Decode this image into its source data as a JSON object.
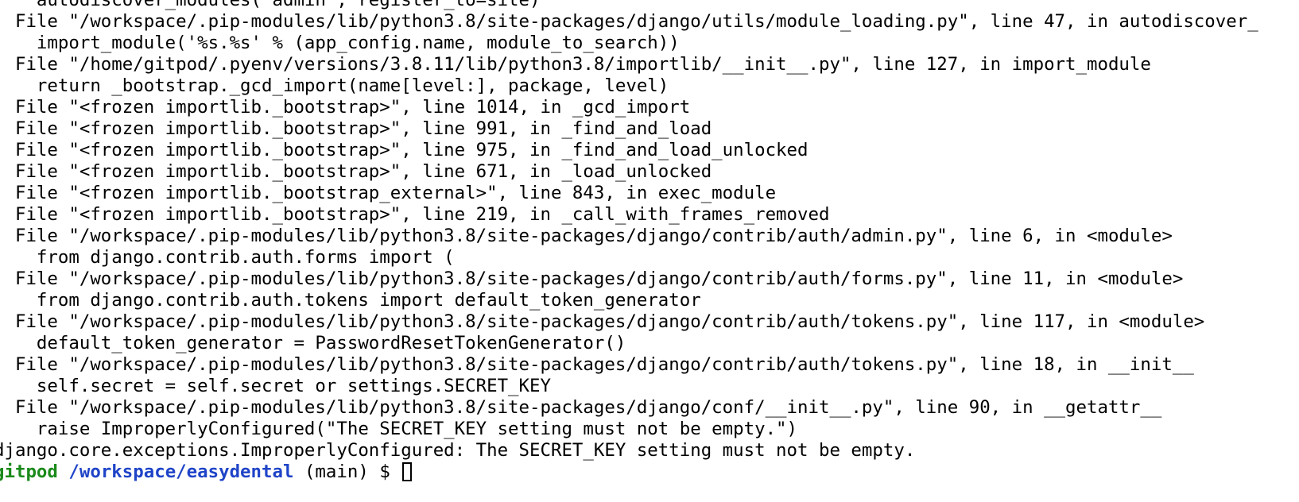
{
  "terminal": {
    "output_lines": [
      "    autodiscover_modules('admin', register_to=site)",
      "  File \"/workspace/.pip-modules/lib/python3.8/site-packages/django/utils/module_loading.py\", line 47, in autodiscover_",
      "    import_module('%s.%s' % (app_config.name, module_to_search))",
      "  File \"/home/gitpod/.pyenv/versions/3.8.11/lib/python3.8/importlib/__init__.py\", line 127, in import_module",
      "    return _bootstrap._gcd_import(name[level:], package, level)",
      "  File \"<frozen importlib._bootstrap>\", line 1014, in _gcd_import",
      "  File \"<frozen importlib._bootstrap>\", line 991, in _find_and_load",
      "  File \"<frozen importlib._bootstrap>\", line 975, in _find_and_load_unlocked",
      "  File \"<frozen importlib._bootstrap>\", line 671, in _load_unlocked",
      "  File \"<frozen importlib._bootstrap_external>\", line 843, in exec_module",
      "  File \"<frozen importlib._bootstrap>\", line 219, in _call_with_frames_removed",
      "  File \"/workspace/.pip-modules/lib/python3.8/site-packages/django/contrib/auth/admin.py\", line 6, in <module>",
      "    from django.contrib.auth.forms import (",
      "  File \"/workspace/.pip-modules/lib/python3.8/site-packages/django/contrib/auth/forms.py\", line 11, in <module>",
      "    from django.contrib.auth.tokens import default_token_generator",
      "  File \"/workspace/.pip-modules/lib/python3.8/site-packages/django/contrib/auth/tokens.py\", line 117, in <module>",
      "    default_token_generator = PasswordResetTokenGenerator()",
      "  File \"/workspace/.pip-modules/lib/python3.8/site-packages/django/contrib/auth/tokens.py\", line 18, in __init__",
      "    self.secret = self.secret or settings.SECRET_KEY",
      "  File \"/workspace/.pip-modules/lib/python3.8/site-packages/django/conf/__init__.py\", line 90, in __getattr__",
      "    raise ImproperlyConfigured(\"The SECRET_KEY setting must not be empty.\")",
      "django.core.exceptions.ImproperlyConfigured: The SECRET_KEY setting must not be empty."
    ],
    "prompt": {
      "user": "gitpod",
      "path": "/workspace/easydental",
      "branch": "(main)",
      "symbol": "$"
    },
    "colors": {
      "background": "#ffffff",
      "text": "#000000",
      "prompt_user": "#1a8a1a",
      "prompt_path": "#1f44c8"
    }
  }
}
